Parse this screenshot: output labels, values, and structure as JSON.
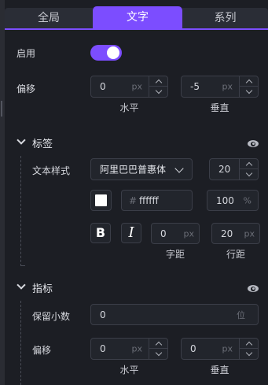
{
  "tabs": [
    {
      "label": "全局",
      "active": false
    },
    {
      "label": "文字",
      "active": true
    },
    {
      "label": "系列",
      "active": false
    }
  ],
  "colors": {
    "accent": "#7c4dff",
    "background": "#1c1e24",
    "input_bg": "#22252c",
    "border": "#3b3e48"
  },
  "enable": {
    "label": "启用",
    "on": true
  },
  "offset": {
    "label": "偏移",
    "horizontal": {
      "value": "0",
      "unit": "px",
      "caption": "水平"
    },
    "vertical": {
      "value": "-5",
      "unit": "px",
      "caption": "垂直"
    }
  },
  "label_section": {
    "title": "标签",
    "visible_icon": "eye-icon",
    "text_style_label": "文本样式",
    "font_family": "阿里巴巴普惠体",
    "font_size": "20",
    "color_hash": "#",
    "color_hex": "ffffff",
    "opacity": "100",
    "opacity_unit": "%",
    "bold_label": "B",
    "italic_label": "I",
    "letter_spacing": {
      "value": "0",
      "unit": "px",
      "caption": "字距"
    },
    "line_height": {
      "value": "20",
      "unit": "px",
      "caption": "行距"
    }
  },
  "indicator_section": {
    "title": "指标",
    "visible_icon": "eye-icon",
    "decimals_label": "保留小数",
    "decimals_value": "0",
    "decimals_unit": "位",
    "offset_label": "偏移",
    "horizontal": {
      "value": "0",
      "unit": "px",
      "caption": "水平"
    },
    "vertical": {
      "value": "0",
      "unit": "px",
      "caption": "垂直"
    }
  }
}
